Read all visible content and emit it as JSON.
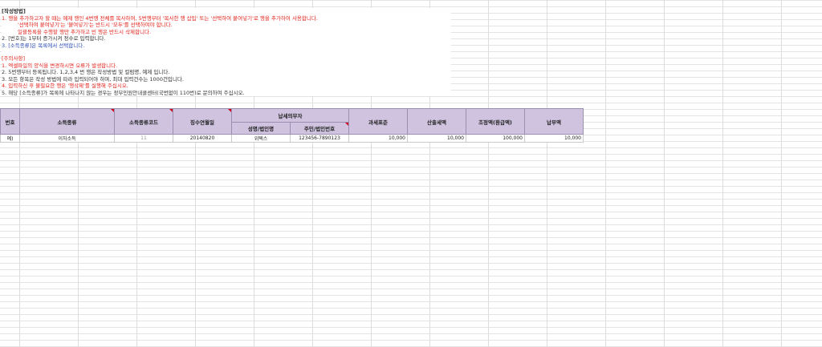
{
  "instructions": {
    "title": "[작성방법]",
    "lines": [
      "1. 행을 추가하고자 할 때는 예제 행인 4번행 전체를 복사하여, 5번행부터 '복사한 행 삽입' 또는 '선택하여 붙여넣기'로 행을 추가하여 사용합니다.",
      "'선택하여 붙여넣기'는 '붙여넣기'는 반드시 '모두'를 선택하여야 합니다.",
      "일괄등록을 수행할 행만 추가하고 빈 행은 반드시 삭제합니다.",
      "2. [번호]는 1부터 증가시켜 정수로 입력합니다.",
      "3. [소득종류]은 목록에서 선택합니다."
    ]
  },
  "cautions": {
    "title": "[주의사항]",
    "lines": [
      "1. 엑셀파일의 양식을 변경하시면 오류가 발생합니다.",
      "2. 5번행부터 등록됩니다. 1,2,3,4 번 행은 작성방법 및 컬럼명, 예제 입니다.",
      "3. 모든 항목은 작성 방법에 따라 입력되어야 하며, 최대 입력건수는 1000건입니다.",
      "4. 입력하신 후 불필요한 행은 '행삭제'를 실행해 주십시오.",
      "5. 해당 [소득종류]가 목록에 나타나지 않는 경우는 정부민원안내콜센터(국번없이 110번)로 문의하여 주십시오."
    ]
  },
  "table": {
    "headers": {
      "no": "번호",
      "income_type": "소득종류",
      "income_code": "소득종류코드",
      "withholding_date": "징수연월일",
      "taxpayer": "납세의무자",
      "name": "성명/법인명",
      "id_no": "주민/법인번호",
      "tax_base": "과세표준",
      "computed_tax": "산출세액",
      "adjusted_tax": "조정액(환급액)",
      "payment_tax": "납부액"
    },
    "example_row": {
      "no": "예)",
      "income_type": "이자소득",
      "income_code": "11",
      "withholding_date": "20140820",
      "name": "위택스",
      "id_no": "123456-7890123",
      "tax_base": "10,000",
      "computed_tax": "10,000",
      "adjusted_tax": "100,000",
      "payment_tax": "10,000"
    }
  },
  "colors": {
    "header_bg": "#cfc3df",
    "red_text": "#e0231c",
    "blue_text": "#2b4bb5",
    "comment_marker": "#d0021b"
  }
}
